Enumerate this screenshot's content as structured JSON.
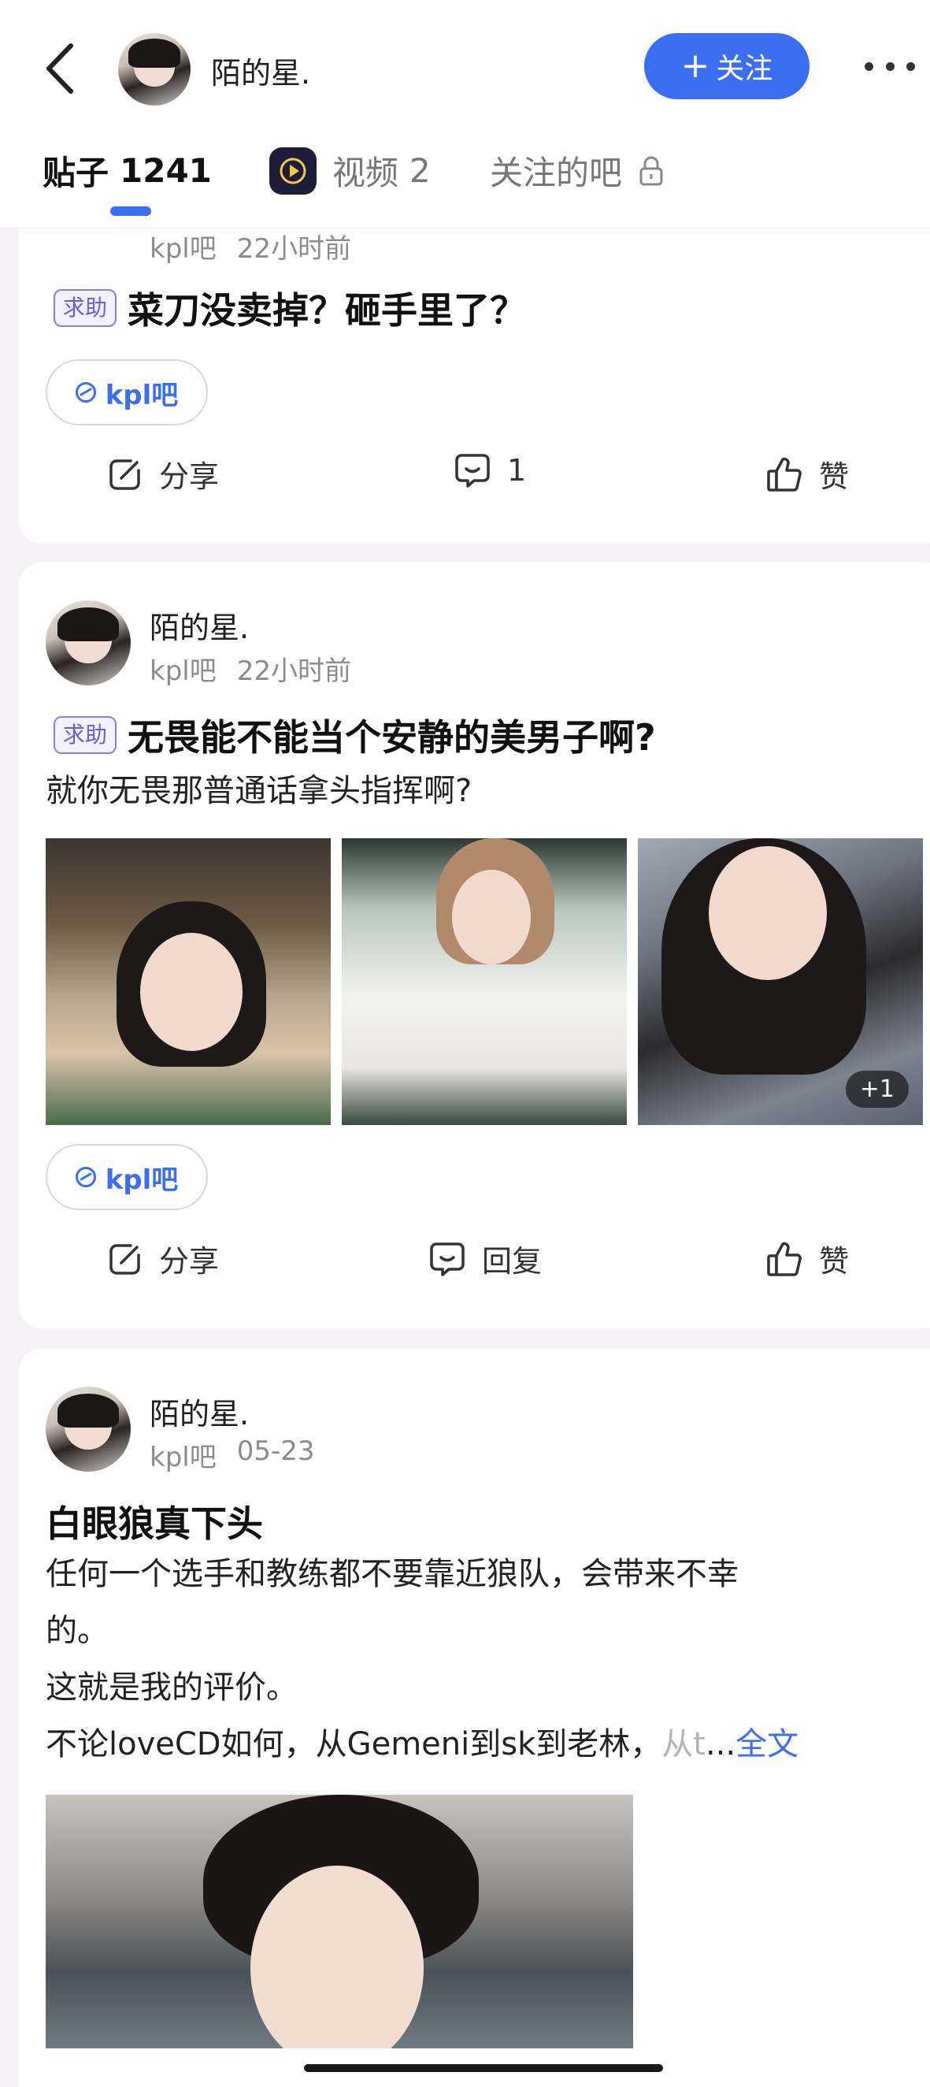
{
  "header": {
    "user_name": "陌的星.",
    "follow_label": "关注"
  },
  "tabs": {
    "posts_label": "贴子",
    "posts_count": "1241",
    "videos_label": "视频",
    "videos_count": "2",
    "followed_forums_label": "关注的吧"
  },
  "posts": [
    {
      "forum": "kpl吧",
      "time": "22小时前",
      "badge": "求助",
      "title": "菜刀没卖掉？砸手里了？",
      "forum_pill": "kpl吧",
      "share_label": "分享",
      "comment_label": "1",
      "like_label": "赞"
    },
    {
      "author": "陌的星.",
      "forum": "kpl吧",
      "time": "22小时前",
      "badge": "求助",
      "title": "无畏能不能当个安静的美男子啊?",
      "body": "就你无畏那普通话拿头指挥啊?",
      "more_images": "+1",
      "forum_pill": "kpl吧",
      "share_label": "分享",
      "comment_label": "回复",
      "like_label": "赞"
    },
    {
      "author": "陌的星.",
      "forum": "kpl吧",
      "time": "05-23",
      "title": "白眼狼真下头",
      "body_lines": [
        "任何一个选手和教练都不要靠近狼队，会带来不幸",
        "的。",
        "这就是我的评价。"
      ],
      "body_last": "不论loveCD如何，从Gemeni到sk到老林，",
      "body_fade": "从t",
      "ellipsis": "...",
      "full_text": "全文"
    }
  ],
  "colors": {
    "accent": "#3b6ef2",
    "badge": "#6b5ce0",
    "background": "#f4f2f5"
  }
}
